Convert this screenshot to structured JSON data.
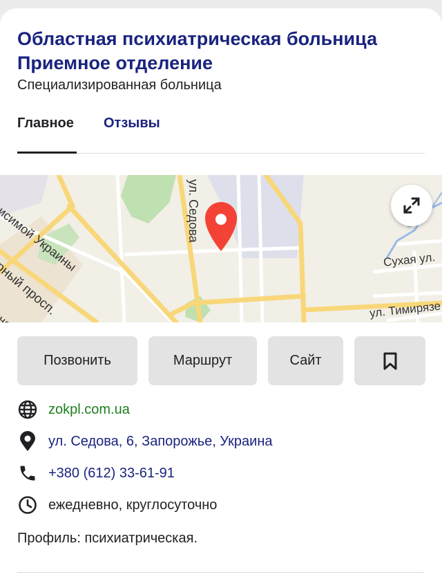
{
  "header": {
    "title": "Областная психиатрическая больница Приемное отделение",
    "category": "Специализированная больница"
  },
  "tabs": [
    {
      "label": "Главное",
      "active": true
    },
    {
      "label": "Отзывы",
      "active": false
    }
  ],
  "map": {
    "street_labels": [
      "ул. Седова",
      "ависимой Украины",
      "орный просп.",
      "Сухая ул.",
      "ул. Тимирязе",
      "ино"
    ],
    "pin_color": "#f44336",
    "expand_icon": "expand-arrows-icon"
  },
  "actions": {
    "call_label": "Позвонить",
    "route_label": "Маршрут",
    "site_label": "Сайт",
    "bookmark_icon": "bookmark-icon"
  },
  "info": {
    "website": "zokpl.com.ua",
    "address": "ул. Седова, 6, Запорожье, Украина",
    "phone": "+380 (612) 33-61-91",
    "hours": "ежедневно, круглосуточно"
  },
  "profile": "Профиль: психиатрическая.",
  "colors": {
    "title": "#1a237e",
    "link_green": "#1e7e1e",
    "button_bg": "#e3e3e3"
  }
}
